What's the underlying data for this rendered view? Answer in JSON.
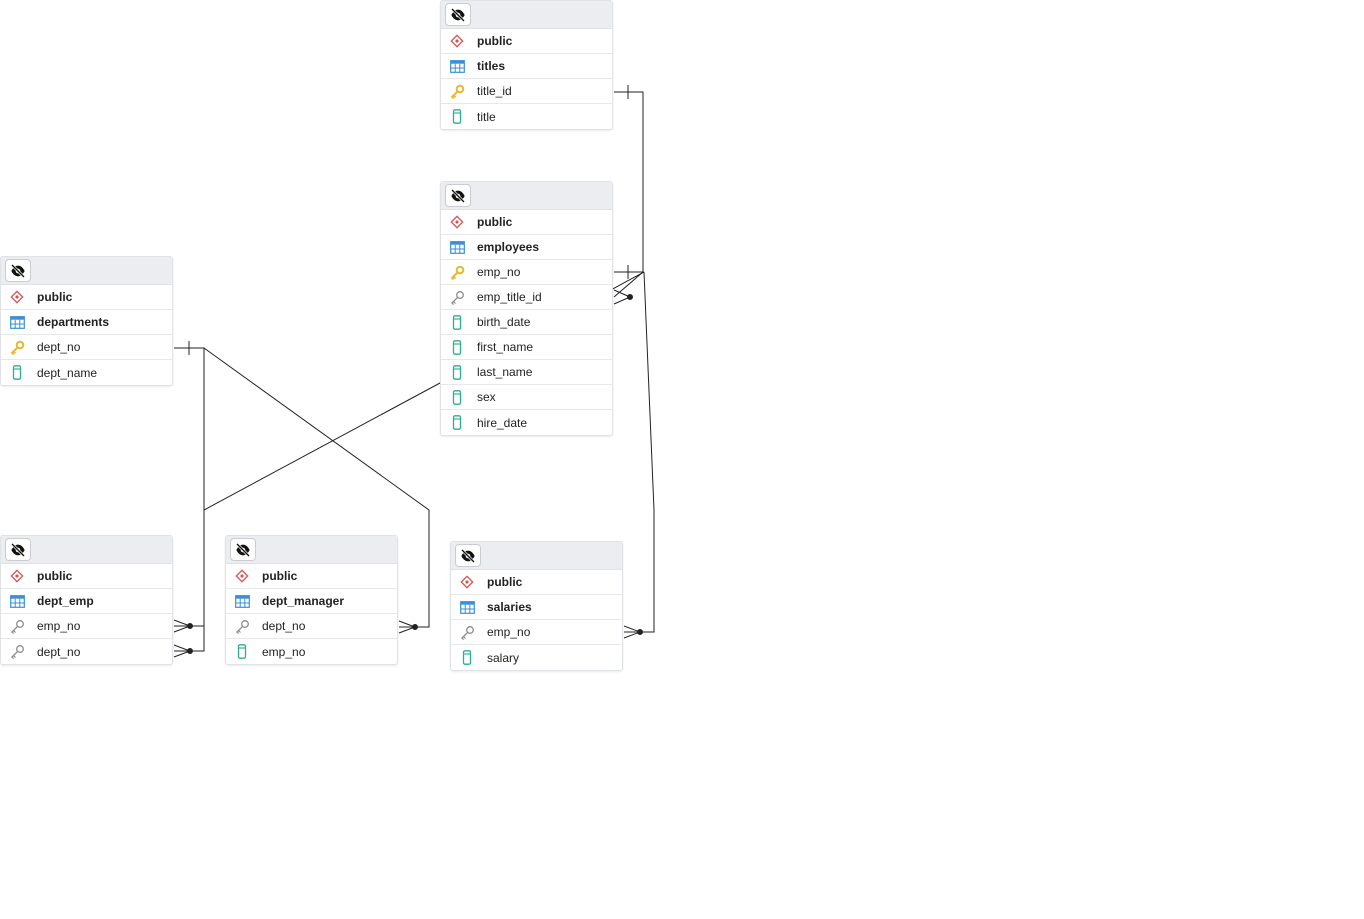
{
  "tables": [
    {
      "id": "titles",
      "schema": "public",
      "name": "titles",
      "columns": [
        {
          "name": "title_id",
          "icon": "primary-key-icon"
        },
        {
          "name": "title",
          "icon": "column-icon"
        }
      ]
    },
    {
      "id": "employees",
      "schema": "public",
      "name": "employees",
      "columns": [
        {
          "name": "emp_no",
          "icon": "primary-key-icon"
        },
        {
          "name": "emp_title_id",
          "icon": "foreign-key-icon"
        },
        {
          "name": "birth_date",
          "icon": "column-icon"
        },
        {
          "name": "first_name",
          "icon": "column-icon"
        },
        {
          "name": "last_name",
          "icon": "column-icon"
        },
        {
          "name": "sex",
          "icon": "column-icon"
        },
        {
          "name": "hire_date",
          "icon": "column-icon"
        }
      ]
    },
    {
      "id": "departments",
      "schema": "public",
      "name": "departments",
      "columns": [
        {
          "name": "dept_no",
          "icon": "primary-key-icon"
        },
        {
          "name": "dept_name",
          "icon": "column-icon"
        }
      ]
    },
    {
      "id": "dept_emp",
      "schema": "public",
      "name": "dept_emp",
      "columns": [
        {
          "name": "emp_no",
          "icon": "foreign-key-icon"
        },
        {
          "name": "dept_no",
          "icon": "foreign-key-icon"
        }
      ]
    },
    {
      "id": "dept_manager",
      "schema": "public",
      "name": "dept_manager",
      "columns": [
        {
          "name": "dept_no",
          "icon": "foreign-key-icon"
        },
        {
          "name": "emp_no",
          "icon": "column-icon"
        }
      ]
    },
    {
      "id": "salaries",
      "schema": "public",
      "name": "salaries",
      "columns": [
        {
          "name": "emp_no",
          "icon": "foreign-key-icon"
        },
        {
          "name": "salary",
          "icon": "column-icon"
        }
      ]
    }
  ],
  "relationships": [
    {
      "from": "employees.emp_title_id",
      "to": "titles.title_id",
      "cardinality": "many-to-one"
    },
    {
      "from": "dept_emp.dept_no",
      "to": "departments.dept_no",
      "cardinality": "many-to-one"
    },
    {
      "from": "dept_manager.dept_no",
      "to": "departments.dept_no",
      "cardinality": "many-to-one"
    },
    {
      "from": "dept_emp.emp_no",
      "to": "employees.emp_no",
      "cardinality": "many-to-one"
    },
    {
      "from": "salaries.emp_no",
      "to": "employees.emp_no",
      "cardinality": "many-to-one"
    }
  ],
  "colors": {
    "header_bg": "#ebedf1",
    "border": "#dfe2e6",
    "schema_icon": "#d9534f",
    "table_icon": "#3a8fd6",
    "primary_key": "#e8b82a",
    "foreign_key": "#9a9a9a",
    "column_icon": "#2cae8f",
    "edge": "#222222"
  }
}
